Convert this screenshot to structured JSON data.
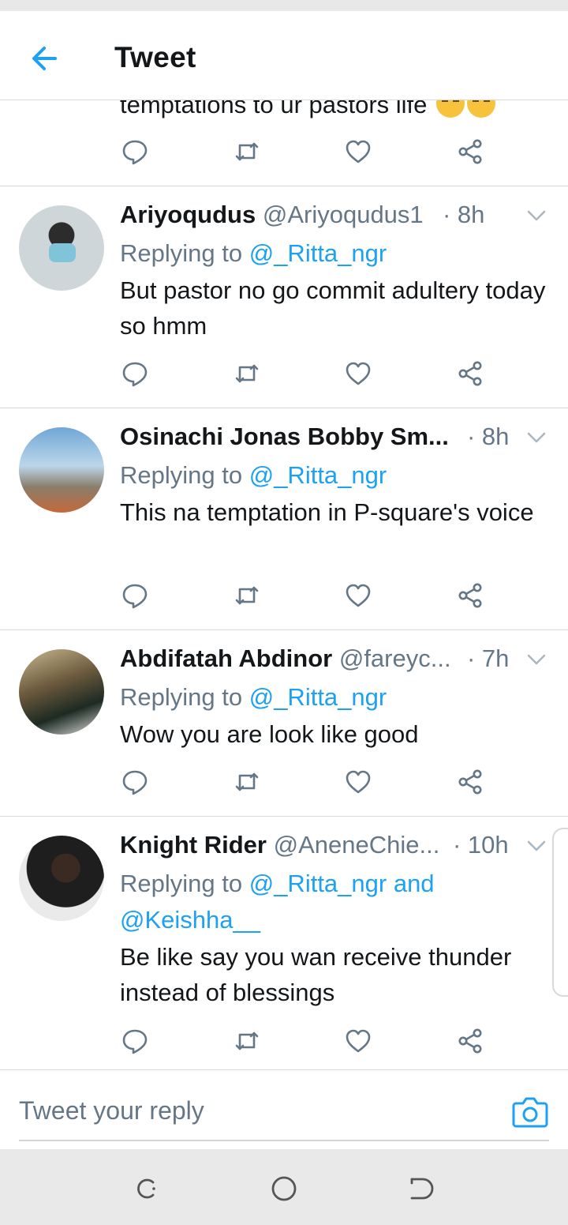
{
  "header": {
    "title": "Tweet"
  },
  "partial_tweet": {
    "text": "temptations to ur pastors life"
  },
  "tweets": [
    {
      "name": "Ariyoqudus",
      "handle": "@Ariyoqudus1",
      "time": "· 8h",
      "replying_prefix": "Replying to",
      "replying_to": "@_Ritta_ngr",
      "replying_extra": "",
      "text": "But pastor no go commit adultery today so hmm"
    },
    {
      "name": "Osinachi Jonas Bobby Sm...",
      "handle": "",
      "time": "· 8h",
      "replying_prefix": "Replying to",
      "replying_to": "@_Ritta_ngr",
      "replying_extra": "",
      "text": "This na temptation  in  P-square's voice"
    },
    {
      "name": "Abdifatah Abdinor",
      "handle": "@fareyc...",
      "time": "· 7h",
      "replying_prefix": "Replying to",
      "replying_to": "@_Ritta_ngr",
      "replying_extra": "",
      "text": "Wow you are look like good"
    },
    {
      "name": "Knight Rider",
      "handle": "@AneneChie...",
      "time": "· 10h",
      "replying_prefix": "Replying to",
      "replying_to": "@_Ritta_ngr and",
      "replying_extra": "@Keishha__",
      "text": "Be like say you wan receive thunder instead of blessings"
    }
  ],
  "compose": {
    "placeholder": "Tweet your reply"
  },
  "icons": {
    "back": "back-arrow-icon",
    "reply": "reply-icon",
    "retweet": "retweet-icon",
    "like": "heart-icon",
    "share": "share-icon",
    "camera": "camera-icon"
  },
  "colors": {
    "accent": "#1da1f2",
    "muted": "#657786",
    "text": "#14171a",
    "divider": "#d8d8d8"
  }
}
